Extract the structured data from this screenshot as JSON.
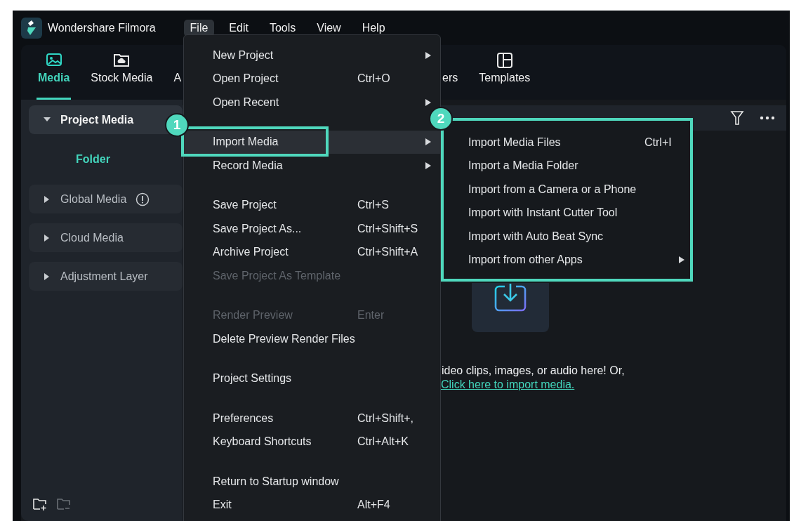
{
  "app": {
    "title": "Wondershare Filmora"
  },
  "menubar": [
    {
      "label": "File",
      "selected": true
    },
    {
      "label": "Edit",
      "selected": false
    },
    {
      "label": "Tools",
      "selected": false
    },
    {
      "label": "View",
      "selected": false
    },
    {
      "label": "Help",
      "selected": false
    }
  ],
  "tabs": [
    {
      "label": "Media",
      "selected": true
    },
    {
      "label": "Stock Media",
      "selected": false
    },
    {
      "label": "A",
      "selected": false
    },
    {
      "label": "ers",
      "selected": false
    },
    {
      "label": "Templates",
      "selected": false
    }
  ],
  "sidebar": {
    "items": [
      {
        "label": "Project Media",
        "selected": true,
        "expanded": true,
        "info": false,
        "children": [
          {
            "label": "Folder"
          }
        ]
      },
      {
        "label": "Global Media",
        "selected": false,
        "expanded": false,
        "info": true
      },
      {
        "label": "Cloud Media",
        "selected": false,
        "expanded": false,
        "info": false
      },
      {
        "label": "Adjustment Layer",
        "selected": false,
        "expanded": false,
        "info": false
      }
    ]
  },
  "import_area": {
    "text": "ideo clips, images, or audio here! Or,",
    "link": "Click here to import media."
  },
  "file_menu": [
    {
      "kind": "item",
      "label": "New Project",
      "submenu": true,
      "selected": false,
      "disabled": false
    },
    {
      "kind": "item",
      "label": "Open Project",
      "shortcut": "Ctrl+O",
      "submenu": false,
      "selected": false,
      "disabled": false
    },
    {
      "kind": "item",
      "label": "Open Recent",
      "submenu": true,
      "selected": false,
      "disabled": false
    },
    {
      "kind": "separator"
    },
    {
      "kind": "item",
      "label": "Import Media",
      "submenu": true,
      "selected": true,
      "disabled": false,
      "annotation": "1"
    },
    {
      "kind": "item",
      "label": "Record Media",
      "submenu": true,
      "selected": false,
      "disabled": false
    },
    {
      "kind": "separator"
    },
    {
      "kind": "item",
      "label": "Save Project",
      "shortcut": "Ctrl+S",
      "submenu": false,
      "selected": false,
      "disabled": false
    },
    {
      "kind": "item",
      "label": "Save Project As...",
      "shortcut": "Ctrl+Shift+S",
      "submenu": false,
      "selected": false,
      "disabled": false
    },
    {
      "kind": "item",
      "label": "Archive Project",
      "shortcut": "Ctrl+Shift+A",
      "submenu": false,
      "selected": false,
      "disabled": false
    },
    {
      "kind": "item",
      "label": "Save Project As Template",
      "submenu": false,
      "selected": false,
      "disabled": true
    },
    {
      "kind": "separator"
    },
    {
      "kind": "item",
      "label": "Render Preview",
      "shortcut": "Enter",
      "submenu": false,
      "selected": false,
      "disabled": true
    },
    {
      "kind": "item",
      "label": "Delete Preview Render Files",
      "submenu": false,
      "selected": false,
      "disabled": false
    },
    {
      "kind": "separator"
    },
    {
      "kind": "item",
      "label": "Project Settings",
      "submenu": false,
      "selected": false,
      "disabled": false
    },
    {
      "kind": "separator"
    },
    {
      "kind": "item",
      "label": "Preferences",
      "shortcut": "Ctrl+Shift+,",
      "submenu": false,
      "selected": false,
      "disabled": false
    },
    {
      "kind": "item",
      "label": "Keyboard Shortcuts",
      "shortcut": "Ctrl+Alt+K",
      "submenu": false,
      "selected": false,
      "disabled": false
    },
    {
      "kind": "separator"
    },
    {
      "kind": "item",
      "label": "Return to Startup window",
      "submenu": false,
      "selected": false,
      "disabled": false
    },
    {
      "kind": "item",
      "label": "Exit",
      "shortcut": "Alt+F4",
      "submenu": false,
      "selected": false,
      "disabled": false
    }
  ],
  "import_submenu": {
    "annotation": "2",
    "items": [
      {
        "label": "Import Media Files",
        "shortcut": "Ctrl+I",
        "submenu": false,
        "selected": false
      },
      {
        "label": "Import a Media Folder",
        "submenu": false,
        "selected": false
      },
      {
        "label": "Import from a Camera or a Phone",
        "submenu": false,
        "selected": false
      },
      {
        "label": "Import with Instant Cutter Tool",
        "submenu": false,
        "selected": false
      },
      {
        "label": "Import with Auto Beat Sync",
        "submenu": false,
        "selected": false
      },
      {
        "label": "Import from other Apps",
        "submenu": true,
        "selected": false
      }
    ]
  }
}
